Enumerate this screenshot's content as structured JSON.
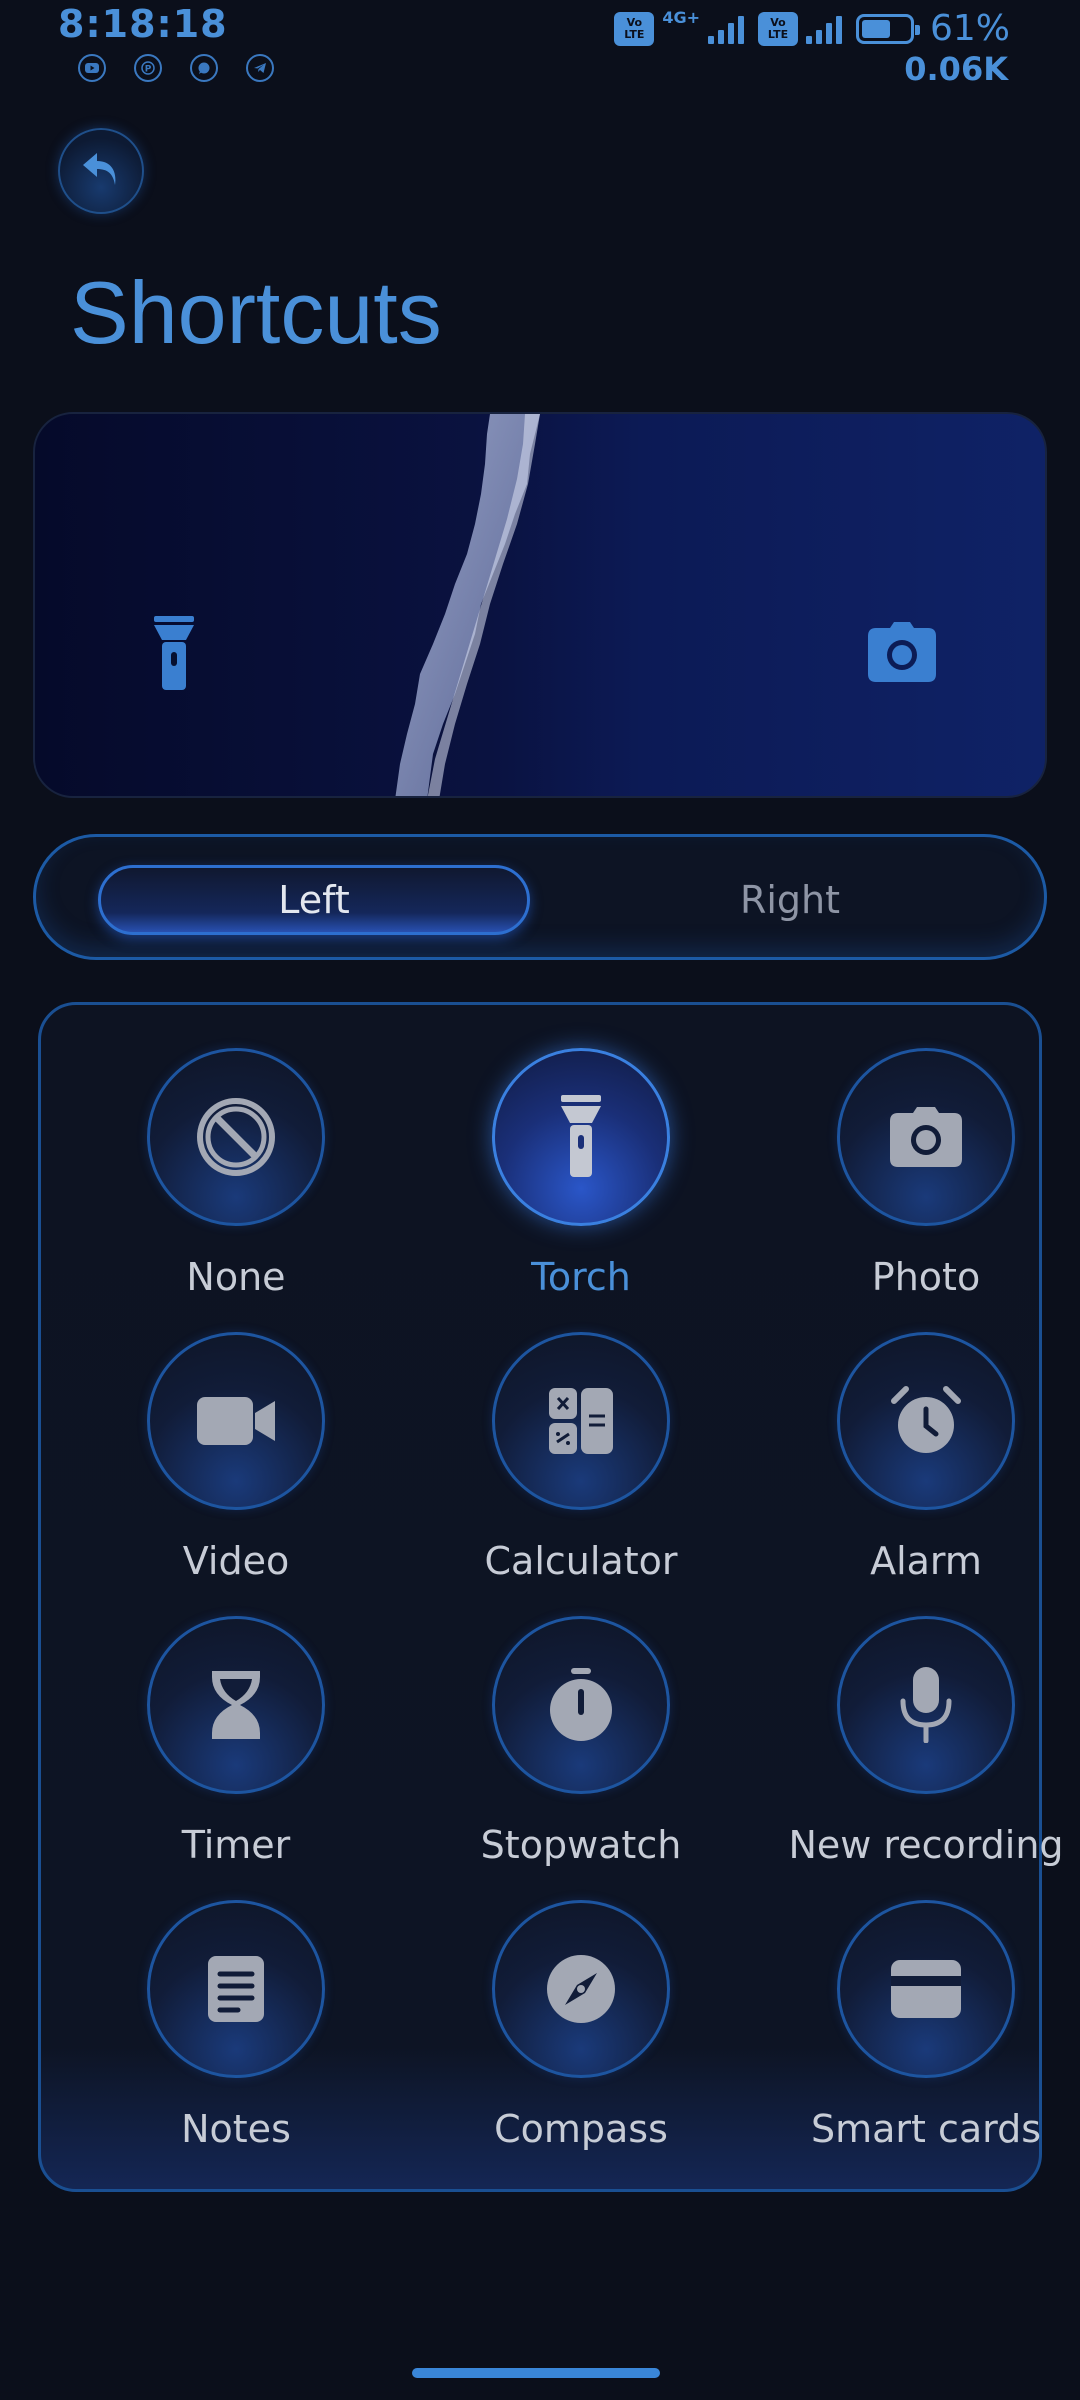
{
  "status_bar": {
    "time": "8:18:18",
    "notifications": [
      "youtube-icon",
      "pinterest-icon",
      "whatsapp-icon",
      "telegram-icon"
    ],
    "volte_label": "Vo LTE",
    "network_type": "4G+",
    "battery_percent": "61%",
    "battery_level": 0.61,
    "net_speed": "0.06K"
  },
  "header": {
    "title": "Shortcuts"
  },
  "preview": {
    "left_shortcut_icon": "torch-icon",
    "right_shortcut_icon": "camera-icon"
  },
  "tabs": {
    "left_label": "Left",
    "right_label": "Right",
    "active": "left"
  },
  "shortcuts": [
    {
      "label": "None",
      "icon": "none-icon"
    },
    {
      "label": "Torch",
      "icon": "torch-icon",
      "selected": true
    },
    {
      "label": "Photo",
      "icon": "camera-icon"
    },
    {
      "label": "Video",
      "icon": "video-icon"
    },
    {
      "label": "Calculator",
      "icon": "calculator-icon"
    },
    {
      "label": "Alarm",
      "icon": "alarm-icon"
    },
    {
      "label": "Timer",
      "icon": "hourglass-icon"
    },
    {
      "label": "Stopwatch",
      "icon": "stopwatch-icon"
    },
    {
      "label": "New recording",
      "icon": "microphone-icon"
    },
    {
      "label": "Notes",
      "icon": "notes-icon"
    },
    {
      "label": "Compass",
      "icon": "compass-icon"
    },
    {
      "label": "Smart cards",
      "icon": "card-icon"
    }
  ],
  "colors": {
    "accent": "#4a90d9",
    "background": "#0b0f1b",
    "panel_border": "#1a4f92",
    "icon_gray": "#a3a8b4"
  }
}
